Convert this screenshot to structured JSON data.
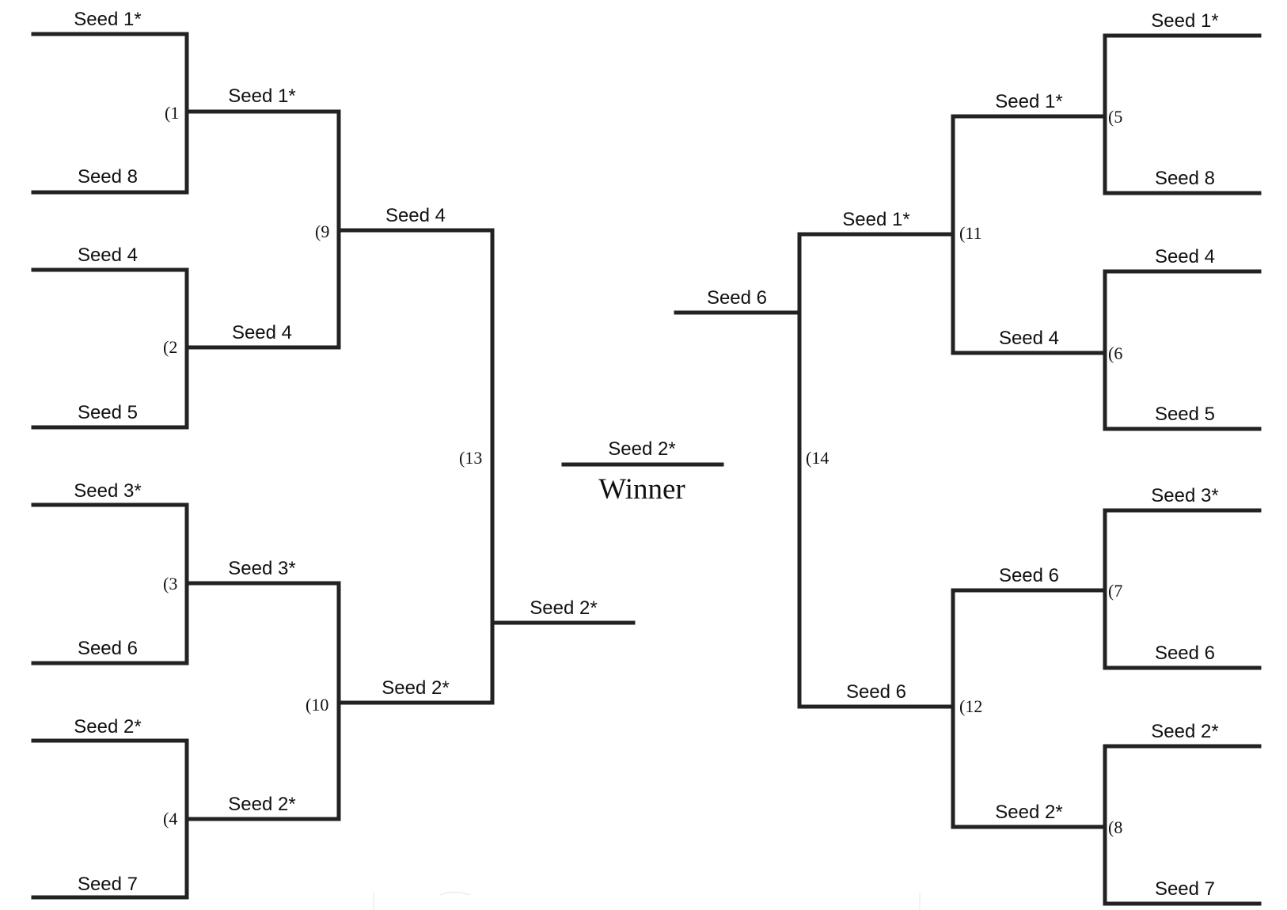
{
  "line_color": "#222222",
  "left": {
    "round1": [
      [
        "Seed 1*",
        "Seed 8"
      ],
      [
        "Seed 4",
        "Seed 5"
      ],
      [
        "Seed 3*",
        "Seed 6"
      ],
      [
        "Seed 2*",
        "Seed 7"
      ]
    ],
    "round2": [
      "Seed 1*",
      "Seed 4",
      "Seed 3*",
      "Seed 2*"
    ],
    "round3": [
      "Seed 4",
      "Seed 2*"
    ],
    "finalist": "Seed 2*",
    "game_numbers": {
      "g1": "(1",
      "g2": "(2",
      "g3": "(3",
      "g4": "(4",
      "g9": "(9",
      "g10": "(10",
      "g13": "(13"
    }
  },
  "right": {
    "round1": [
      [
        "Seed 1*",
        "Seed 8"
      ],
      [
        "Seed 4",
        "Seed 5"
      ],
      [
        "Seed 3*",
        "Seed 6"
      ],
      [
        "Seed 2*",
        "Seed 7"
      ]
    ],
    "round2": [
      "Seed 1*",
      "Seed 4",
      "Seed 6",
      "Seed 2*"
    ],
    "round3": [
      "Seed 1*",
      "Seed 6"
    ],
    "finalist": "Seed 6",
    "game_numbers": {
      "g5": "(5",
      "g6": "(6",
      "g7": "(7",
      "g8": "(8",
      "g11": "(11",
      "g12": "(12",
      "g14": "(14"
    }
  },
  "champion": "Seed 2*",
  "winner_caption": "Winner"
}
